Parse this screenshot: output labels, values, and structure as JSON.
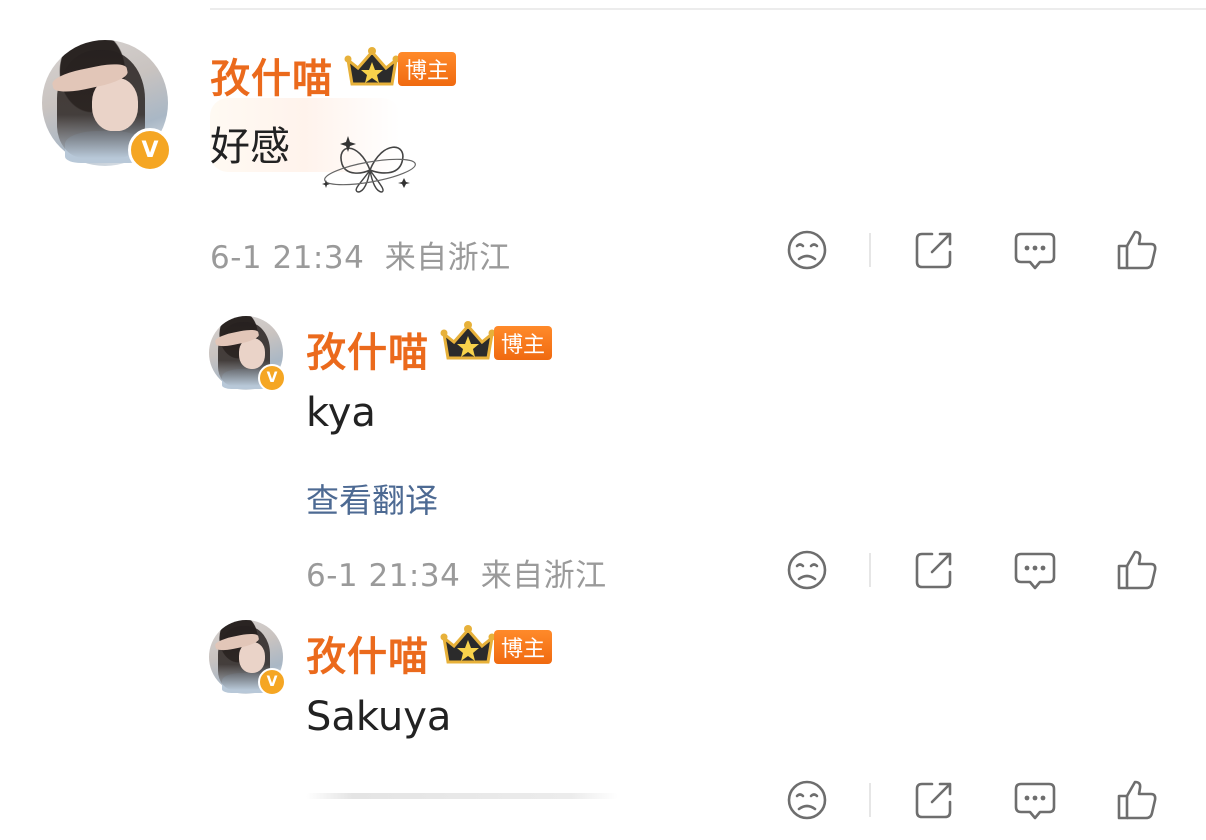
{
  "comments": [
    {
      "user_name": "孜什喵",
      "badge_label": "博主",
      "verified_letter": "V",
      "content": "好感",
      "timestamp": "6-1 21:34",
      "location": "来自浙江",
      "decoration": "butterfly-sticker"
    },
    {
      "user_name": "孜什喵",
      "badge_label": "博主",
      "verified_letter": "V",
      "content": "kya",
      "translate_link": "查看翻译",
      "timestamp": "6-1 21:34",
      "location": "来自浙江"
    },
    {
      "user_name": "孜什喵",
      "badge_label": "博主",
      "verified_letter": "V",
      "content": "Sakuya"
    }
  ],
  "actions": {
    "icons": [
      "dislike-icon",
      "share-icon",
      "comment-icon",
      "like-icon"
    ]
  },
  "colors": {
    "name": "#eb6a1c",
    "badge": "#f06a10",
    "verified": "#f5a623",
    "meta": "#9a9a9a",
    "translate_link": "#4d6a93",
    "text": "#222222"
  }
}
